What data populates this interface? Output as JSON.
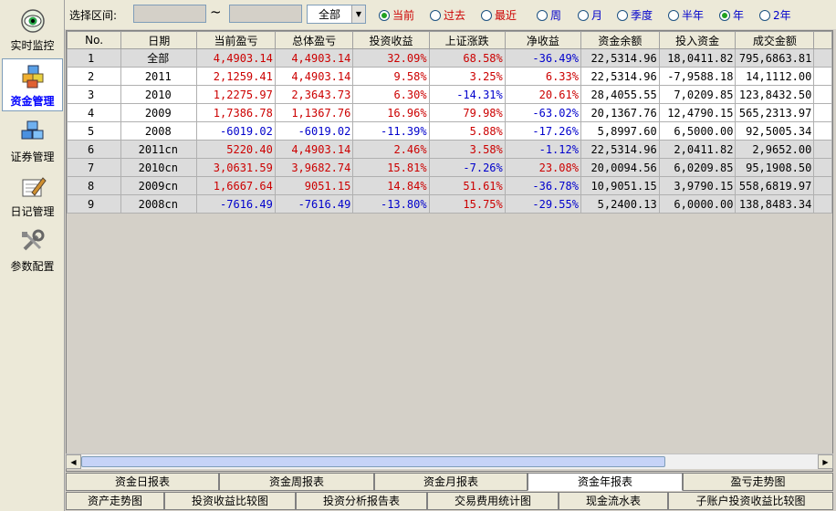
{
  "sidebar": {
    "items": [
      {
        "label": "实时监控",
        "icon": "eye-icon",
        "active": false
      },
      {
        "label": "资金管理",
        "icon": "funds-cubes-icon",
        "active": true
      },
      {
        "label": "证券管理",
        "icon": "securities-cubes-icon",
        "active": false
      },
      {
        "label": "日记管理",
        "icon": "diary-pen-icon",
        "active": false
      },
      {
        "label": "参数配置",
        "icon": "tools-icon",
        "active": false
      }
    ]
  },
  "filter": {
    "range_label": "选择区间:",
    "start_value": "",
    "end_value": "",
    "tilde": "~",
    "account_select": "全部",
    "period_radios": [
      {
        "label": "当前",
        "checked": true
      },
      {
        "label": "过去",
        "checked": false
      },
      {
        "label": "最近",
        "checked": false
      }
    ],
    "span_radios": [
      {
        "label": "周",
        "checked": false
      },
      {
        "label": "月",
        "checked": false
      },
      {
        "label": "季度",
        "checked": false
      },
      {
        "label": "半年",
        "checked": false
      },
      {
        "label": "年",
        "checked": true
      },
      {
        "label": "2年",
        "checked": false
      }
    ]
  },
  "table": {
    "headers": [
      "No.",
      "日期",
      "当前盈亏",
      "总体盈亏",
      "投资收益",
      "上证涨跌",
      "净收益",
      "资金余额",
      "投入资金",
      "成交金额"
    ],
    "rows": [
      [
        "1",
        "全部",
        "4,4903.14",
        "4,4903.14",
        "32.09%",
        "68.58%",
        "-36.49%",
        "22,5314.96",
        "18,0411.82",
        "795,6863.81"
      ],
      [
        "2",
        "2011",
        "2,1259.41",
        "4,4903.14",
        "9.58%",
        "3.25%",
        "6.33%",
        "22,5314.96",
        "-7,9588.18",
        "14,1112.00"
      ],
      [
        "3",
        "2010",
        "1,2275.97",
        "2,3643.73",
        "6.30%",
        "-14.31%",
        "20.61%",
        "28,4055.55",
        "7,0209.85",
        "123,8432.50"
      ],
      [
        "4",
        "2009",
        "1,7386.78",
        "1,1367.76",
        "16.96%",
        "79.98%",
        "-63.02%",
        "20,1367.76",
        "12,4790.15",
        "565,2313.97"
      ],
      [
        "5",
        "2008",
        "-6019.02",
        "-6019.02",
        "-11.39%",
        "5.88%",
        "-17.26%",
        "5,8997.60",
        "6,5000.00",
        "92,5005.34"
      ],
      [
        "6",
        "2011cn",
        "5220.40",
        "4,4903.14",
        "2.46%",
        "3.58%",
        "-1.12%",
        "22,5314.96",
        "2,0411.82",
        "2,9652.00"
      ],
      [
        "7",
        "2010cn",
        "3,0631.59",
        "3,9682.74",
        "15.81%",
        "-7.26%",
        "23.08%",
        "20,0094.56",
        "6,0209.85",
        "95,1908.50"
      ],
      [
        "8",
        "2009cn",
        "1,6667.64",
        "9051.15",
        "14.84%",
        "51.61%",
        "-36.78%",
        "10,9051.15",
        "3,9790.15",
        "558,6819.97"
      ],
      [
        "9",
        "2008cn",
        "-7616.49",
        "-7616.49",
        "-13.80%",
        "15.75%",
        "-29.55%",
        "5,2400.13",
        "6,0000.00",
        "138,8483.34"
      ]
    ]
  },
  "tabs_row1": [
    {
      "label": "资金日报表",
      "active": false
    },
    {
      "label": "资金周报表",
      "active": false
    },
    {
      "label": "资金月报表",
      "active": false
    },
    {
      "label": "资金年报表",
      "active": true
    },
    {
      "label": "盈亏走势图",
      "active": false
    }
  ],
  "tabs_row2": [
    {
      "label": "资产走势图"
    },
    {
      "label": "投资收益比较图"
    },
    {
      "label": "投资分析报告表"
    },
    {
      "label": "交易费用统计图"
    },
    {
      "label": "现金流水表"
    },
    {
      "label": "子账户投资收益比较图"
    }
  ],
  "colors": {
    "positive": "#cc0000",
    "negative": "#0000cc",
    "accent": "#0000ff"
  }
}
